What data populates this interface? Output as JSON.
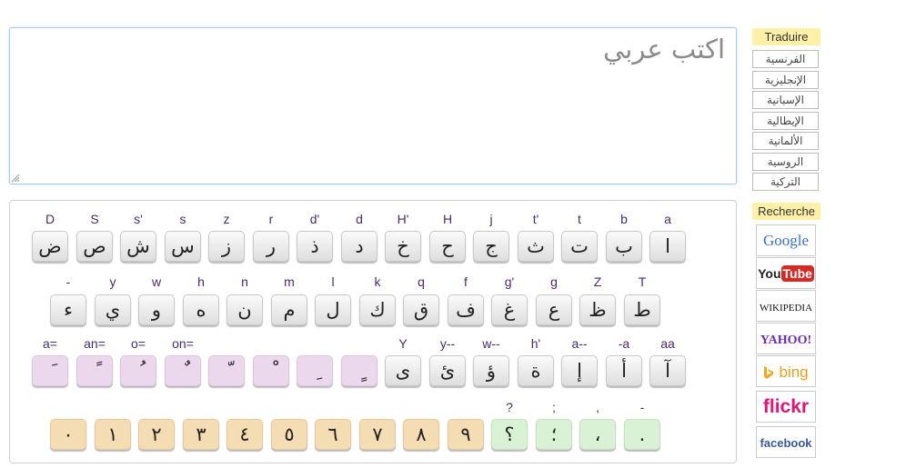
{
  "editor": {
    "placeholder": "اكتب عربي"
  },
  "keyboard": {
    "row1": {
      "labels": [
        "D",
        "S",
        "s'",
        "s",
        "z",
        "r",
        "d'",
        "d",
        "H'",
        "H",
        "j",
        "t'",
        "t",
        "b",
        "a"
      ],
      "keys": [
        "ض",
        "ص",
        "ش",
        "س",
        "ز",
        "ر",
        "ذ",
        "د",
        "خ",
        "ح",
        "ج",
        "ث",
        "ت",
        "ب",
        "ا"
      ]
    },
    "row2": {
      "labels": [
        "-",
        "y",
        "w",
        "h",
        "n",
        "m",
        "l",
        "k",
        "q",
        "f",
        "g'",
        "g",
        "Z",
        "T"
      ],
      "keys": [
        "ء",
        "ي",
        "و",
        "ه",
        "ن",
        "م",
        "ل",
        "ك",
        "ق",
        "ف",
        "غ",
        "ع",
        "ظ",
        "ط"
      ]
    },
    "row3": {
      "labels": [
        "a=",
        "an=",
        "o=",
        "on=",
        "",
        "",
        "",
        "",
        "Y",
        "y--",
        "w--",
        "h'",
        "a--",
        "-a",
        "aa"
      ],
      "keys": [
        "َ",
        "ً",
        "ُ",
        "ٌ",
        "ّ",
        "ْ",
        "ِ",
        "ٍ",
        "ى",
        "ئ",
        "ؤ",
        "ة",
        "إ",
        "أ",
        "آ"
      ]
    },
    "row4": {
      "labels": [
        "",
        "",
        "",
        "",
        "",
        "",
        "",
        "",
        "",
        "",
        "?",
        ";",
        ",",
        "-"
      ],
      "keys": [
        "٠",
        "١",
        "٢",
        "٣",
        "٤",
        "٥",
        "٦",
        "٧",
        "٨",
        "٩",
        "؟",
        "؛",
        "،",
        "."
      ]
    }
  },
  "sidebar": {
    "translate_heading": "Traduire",
    "languages": [
      "الفرنسية",
      "الإنجليزية",
      "الإسبانية",
      "الإيطالية",
      "الألمانية",
      "الروسية",
      "التركية"
    ],
    "search_heading": "Recherche",
    "engines": [
      "Google",
      "You",
      "Tube",
      "WIKIPEDIA",
      "YAHOO!",
      "bing",
      "flickr",
      "facebook"
    ]
  },
  "colors": {
    "accent_border": "#a9c9e6",
    "heading_bg": "#fff0a8",
    "diacritic_key": "#ecd8ec",
    "digit_key": "#f4dcb3",
    "punct_key": "#d9f2d5"
  }
}
